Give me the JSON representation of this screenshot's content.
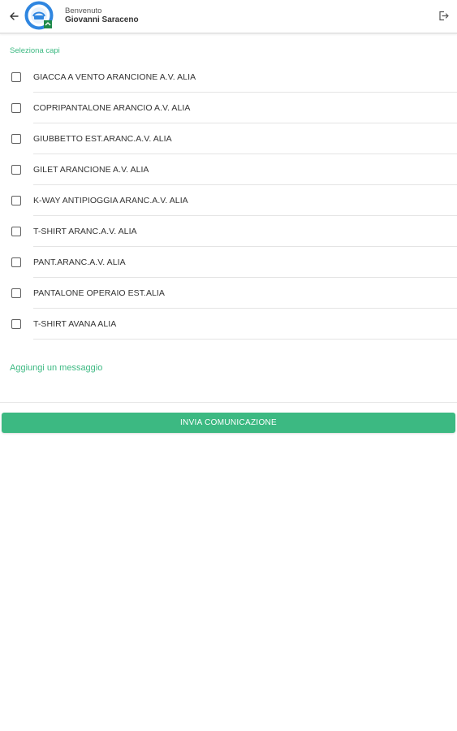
{
  "header": {
    "welcome": "Benvenuto",
    "user_name": "Giovanni Saraceno"
  },
  "icons": {
    "back": "arrow-left-icon",
    "logo": "app-logo",
    "logout": "logout-icon"
  },
  "colors": {
    "accent": "#3cb982",
    "logo_ring": "#2f86e0"
  },
  "selection": {
    "label": "Seleziona capi",
    "items": [
      {
        "label": "GIACCA A VENTO ARANCIONE A.V. ALIA",
        "checked": false
      },
      {
        "label": "COPRIPANTALONE ARANCIO A.V. ALIA",
        "checked": false
      },
      {
        "label": "GIUBBETTO EST.ARANC.A.V. ALIA",
        "checked": false
      },
      {
        "label": "GILET ARANCIONE A.V. ALIA",
        "checked": false
      },
      {
        "label": "K-WAY ANTIPIOGGIA ARANC.A.V. ALIA",
        "checked": false
      },
      {
        "label": "T-SHIRT ARANC.A.V. ALIA",
        "checked": false
      },
      {
        "label": "PANT.ARANC.A.V. ALIA",
        "checked": false
      },
      {
        "label": "PANTALONE OPERAIO EST.ALIA",
        "checked": false
      },
      {
        "label": "T-SHIRT AVANA ALIA",
        "checked": false
      }
    ]
  },
  "message": {
    "link_label": "Aggiungi un messaggio"
  },
  "actions": {
    "send_label": "INVIA COMUNICAZIONE"
  }
}
